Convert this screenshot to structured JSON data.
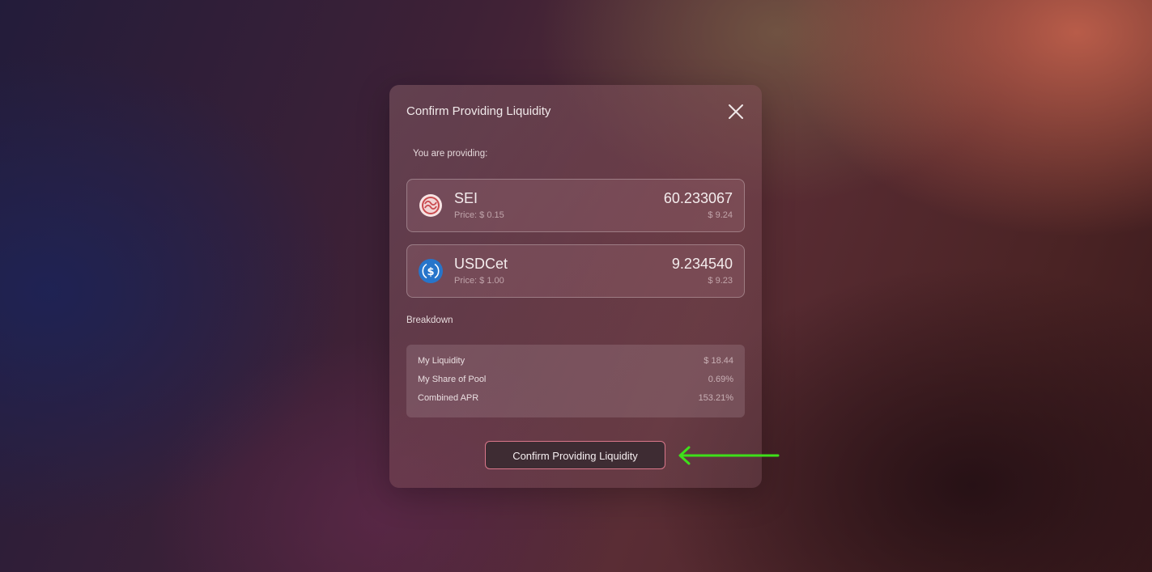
{
  "modal": {
    "title": "Confirm Providing Liquidity",
    "providing_label": "You are providing:",
    "tokens": [
      {
        "name": "SEI",
        "price": "Price: $ 0.15",
        "amount": "60.233067",
        "usd_value": "$ 9.24",
        "icon": "sei-token-icon"
      },
      {
        "name": "USDCet",
        "price": "Price: $ 1.00",
        "amount": "9.234540",
        "usd_value": "$ 9.23",
        "icon": "usdc-token-icon"
      }
    ],
    "breakdown": {
      "label": "Breakdown",
      "rows": [
        {
          "key": "My Liquidity",
          "value": "$ 18.44"
        },
        {
          "key": "My Share of Pool",
          "value": "0.69%"
        },
        {
          "key": "Combined APR",
          "value": "153.21%"
        }
      ]
    },
    "confirm_button_label": "Confirm Providing Liquidity",
    "close_icon": "close-icon"
  },
  "colors": {
    "accent_border": "#d9778a",
    "button_bg": "#3e2c33",
    "annotation_arrow": "#3ee01a"
  }
}
